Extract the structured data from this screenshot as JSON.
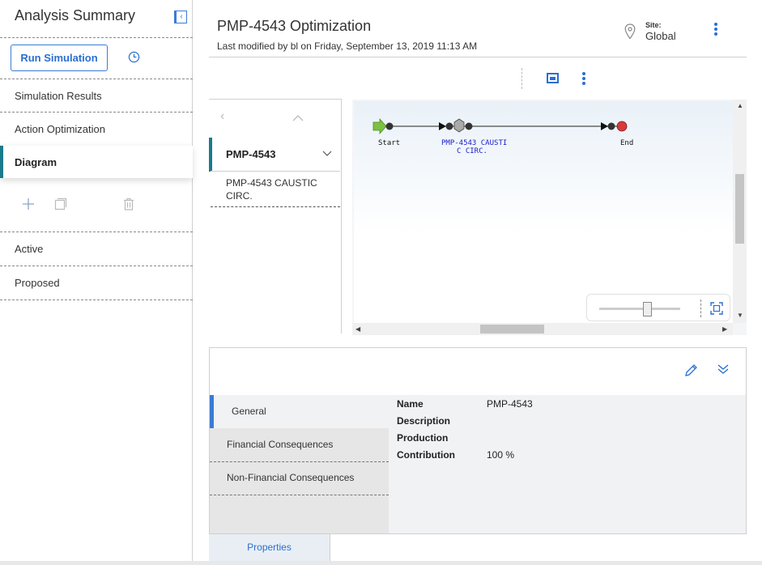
{
  "sidebar": {
    "title": "Analysis Summary",
    "run_simulation_label": "Run Simulation",
    "items": [
      {
        "label": "Simulation Results"
      },
      {
        "label": "Action Optimization"
      },
      {
        "label": "Diagram"
      },
      {
        "label": "Active"
      },
      {
        "label": "Proposed"
      }
    ]
  },
  "header": {
    "title": "PMP-4543 Optimization",
    "modified": "Last modified by bl on Friday, September 13, 2019 11:13 AM",
    "site_label": "Site:",
    "site_value": "Global"
  },
  "tree": {
    "selected": "PMP-4543",
    "items": [
      {
        "label": "PMP-4543 CAUSTIC CIRC."
      }
    ]
  },
  "diagram": {
    "start_label": "Start",
    "node_label_line1": "PMP-4543 CAUSTI",
    "node_label_line2": "C CIRC.",
    "end_label": "End",
    "zoom_level": 0.6
  },
  "properties": {
    "tabs": [
      {
        "label": "General"
      },
      {
        "label": "Financial Consequences"
      },
      {
        "label": "Non-Financial Consequences"
      }
    ],
    "fields": [
      {
        "label": "Name",
        "value": "PMP-4543"
      },
      {
        "label": "Description",
        "value": ""
      },
      {
        "label": "Production",
        "value": ""
      },
      {
        "label": "Contribution",
        "value": "100 %"
      }
    ],
    "bottom_tab": "Properties"
  },
  "colors": {
    "accent": "#2a6fd0",
    "teal": "#1b7a8c",
    "start_node": "#7cc142",
    "end_node": "#d83a3a"
  },
  "icons": [
    "collapse-panel-icon",
    "history-icon",
    "add-icon",
    "copy-icon",
    "delete-icon",
    "location-pin-icon",
    "more-vertical-icon",
    "layout-icon",
    "chevron-left-icon",
    "chevron-up-icon",
    "chevron-down-icon",
    "fit-to-screen-icon",
    "edit-icon",
    "double-chevron-down-icon"
  ]
}
